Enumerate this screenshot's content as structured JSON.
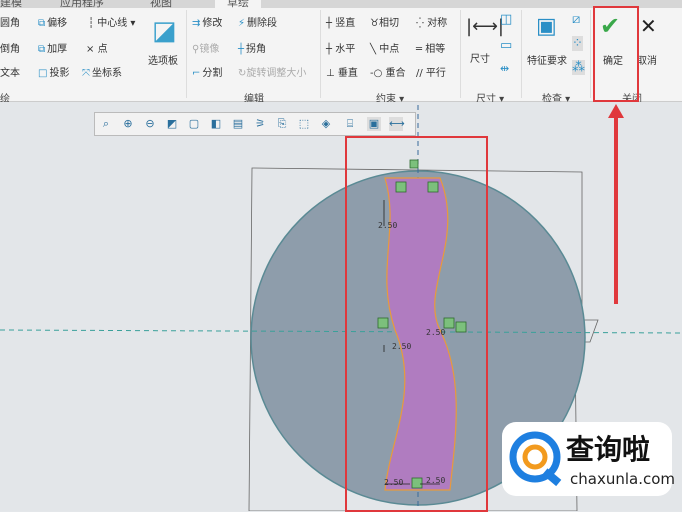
{
  "tabs": [
    "建模",
    "应用程序",
    "视图",
    "草绘"
  ],
  "sketch": {
    "items": [
      "圆角",
      "倒角",
      "文本"
    ],
    "items2": [
      "偏移",
      "加厚",
      "投影"
    ],
    "items3": [
      "中心线",
      "点",
      "坐标系"
    ],
    "palette": "选项板",
    "group": "绘"
  },
  "edit": {
    "items": [
      "修改",
      "镜像",
      "分割"
    ],
    "items2": [
      "删除段",
      "拐角",
      "旋转调整大小"
    ],
    "group": "编辑"
  },
  "constrain": {
    "items": [
      "竖直",
      "水平",
      "垂直"
    ],
    "items2": [
      "相切",
      "中点",
      "重合"
    ],
    "items3": [
      "对称",
      "相等",
      "平行"
    ],
    "group": "约束"
  },
  "dimension": {
    "label": "尺寸",
    "group": "尺寸"
  },
  "inspect": {
    "label": "特征要求",
    "group": "检查"
  },
  "close": {
    "ok": "确定",
    "cancel": "取消",
    "group": "关闭"
  },
  "dims": [
    "2.50",
    "2.50",
    "2.50",
    "2.50",
    "2.50"
  ],
  "watermark": {
    "name": "查询啦",
    "url": "chaxunla.com"
  },
  "colors": {
    "highlight": "#e0383c",
    "check": "#3aa84a",
    "shape": "#b07cc0",
    "part": "#8e9dab"
  }
}
